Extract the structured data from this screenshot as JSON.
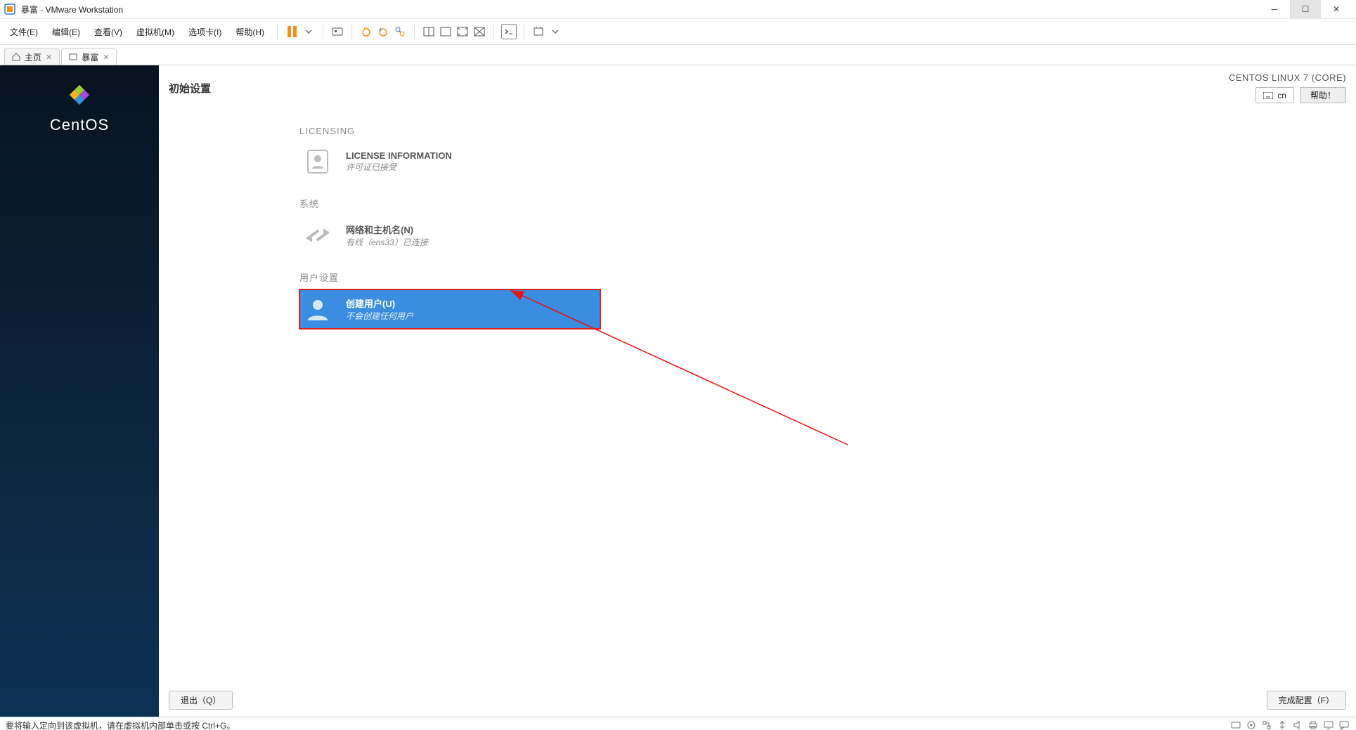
{
  "window": {
    "title": "暴富 - VMware Workstation"
  },
  "menubar": {
    "file": "文件(E)",
    "edit": "编辑(E)",
    "view": "查看(V)",
    "vm": "虚拟机(M)",
    "tabs": "选项卡(I)",
    "help": "帮助(H)"
  },
  "tabs": {
    "home": "主页",
    "vm": "暴富"
  },
  "sidebar": {
    "brand": "CentOS"
  },
  "guest": {
    "title": "初始设置",
    "os_label": "CENTOS LINUX 7 (CORE)",
    "lang_code": "cn",
    "help_button": "帮助！",
    "cat_licensing": "LICENSING",
    "license": {
      "title": "LICENSE INFORMATION",
      "sub": "许可证已接受"
    },
    "cat_system": "系统",
    "network": {
      "title": "网络和主机名(N)",
      "sub": "有线（ens33）已连接"
    },
    "cat_user": "用户设置",
    "user": {
      "title": "创建用户(U)",
      "sub": "不会创建任何用户"
    },
    "quit_button": "退出（Q）",
    "finish_button": "完成配置（F）"
  },
  "statusbar": {
    "hint": "要将输入定向到该虚拟机，请在虚拟机内部单击或按 Ctrl+G。"
  }
}
